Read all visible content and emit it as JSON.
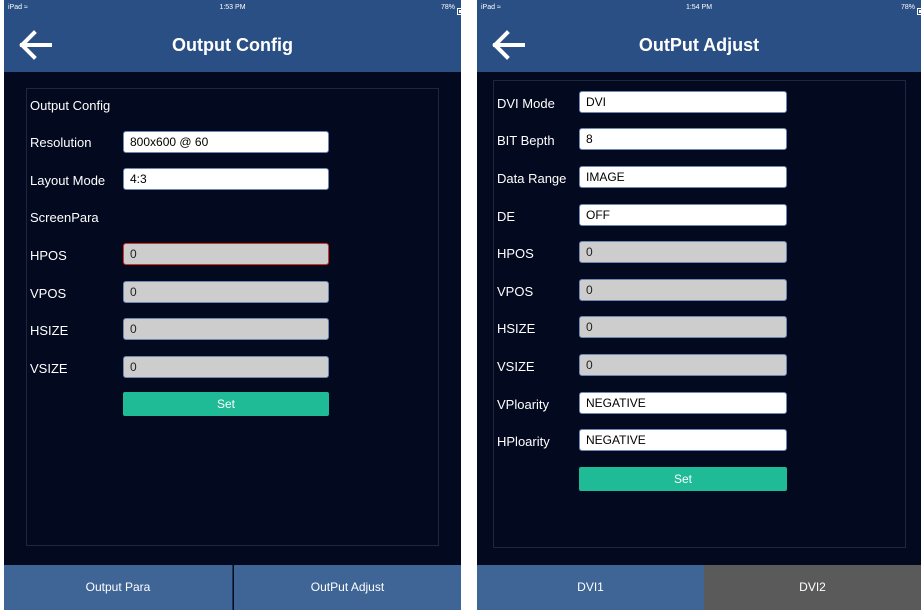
{
  "left": {
    "status": {
      "device": "iPad",
      "time": "1:53 PM",
      "battery": "78%"
    },
    "nav": {
      "title": "Output Config"
    },
    "section_title": "Output Config",
    "resolution": {
      "label": "Resolution",
      "value": "800x600 @ 60"
    },
    "layout_mode": {
      "label": "Layout Mode",
      "value": "4:3"
    },
    "screen_para_label": "ScreenPara",
    "hpos": {
      "label": "HPOS",
      "value": "0"
    },
    "vpos": {
      "label": "VPOS",
      "value": "0"
    },
    "hsize": {
      "label": "HSIZE",
      "value": "0"
    },
    "vsize": {
      "label": "VSIZE",
      "value": "0"
    },
    "set_label": "Set",
    "tabs": [
      "Output Para",
      "OutPut Adjust"
    ]
  },
  "right": {
    "status": {
      "device": "iPad",
      "time": "1:54 PM",
      "battery": "78%"
    },
    "nav": {
      "title": "OutPut Adjust"
    },
    "dvi_mode": {
      "label": "DVI Mode",
      "value": "DVI"
    },
    "bit_depth": {
      "label": "BIT Bepth",
      "value": "8"
    },
    "data_range": {
      "label": "Data Range",
      "value": "IMAGE"
    },
    "de": {
      "label": "DE",
      "value": "OFF"
    },
    "hpos": {
      "label": "HPOS",
      "value": "0"
    },
    "vpos": {
      "label": "VPOS",
      "value": "0"
    },
    "hsize": {
      "label": "HSIZE",
      "value": "0"
    },
    "vsize": {
      "label": "VSIZE",
      "value": "0"
    },
    "vpolarity": {
      "label": "VPloarity",
      "value": "NEGATIVE"
    },
    "hpolarity": {
      "label": "HPloarity",
      "value": "NEGATIVE"
    },
    "set_label": "Set",
    "tabs": [
      "DVI1",
      "DVI2"
    ]
  },
  "colors": {
    "nav_bar": "#2a4f84",
    "background": "#03091e",
    "set_button": "#1fbb97",
    "tab_active": "#3e6596",
    "tab_inactive": "#5a5a5a",
    "invalid_border": "#e0302b"
  },
  "icons": {
    "back": "back-arrow-icon",
    "wifi": "wifi-icon",
    "battery": "battery-icon"
  }
}
